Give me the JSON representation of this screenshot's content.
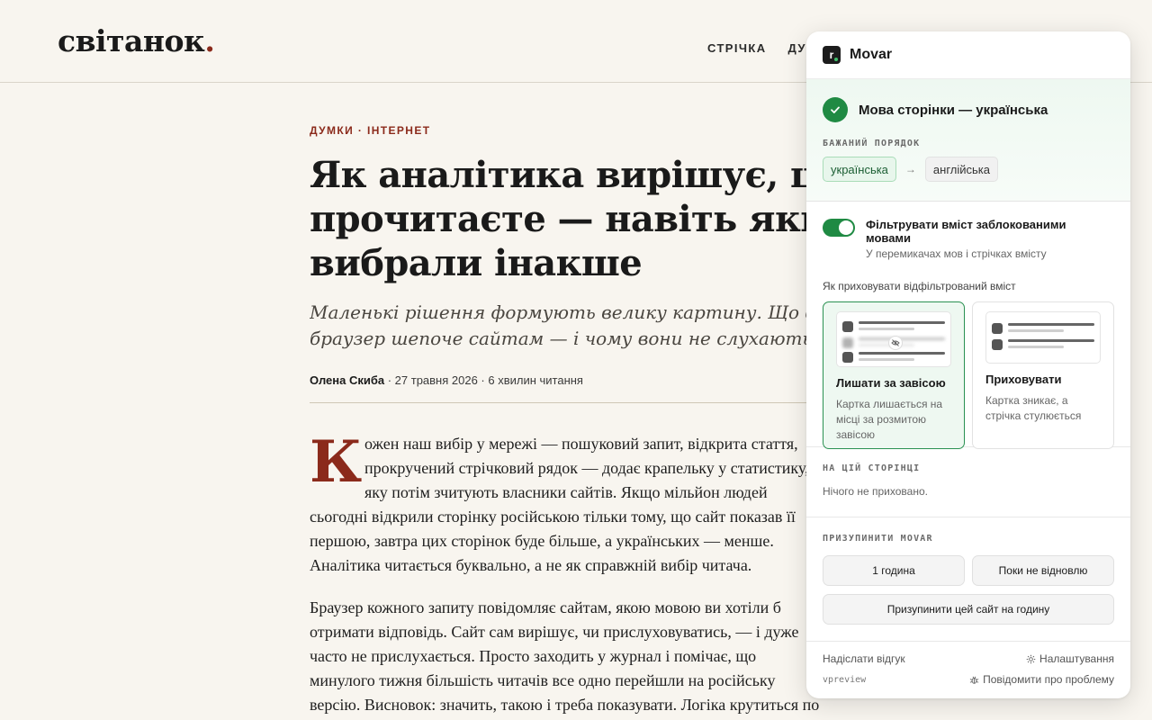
{
  "site": {
    "logo": "світанок",
    "logo_dot": ".",
    "nav": [
      "СТРІЧКА",
      "ДУМКИ"
    ]
  },
  "article": {
    "kicker": "ДУМКИ · ІНТЕРНЕТ",
    "headline_lines": [
      "Як аналітика вирішує, що ви",
      "прочитаєте — навіть якщо ви",
      "вибрали інакше"
    ],
    "dek_lines": [
      "Маленькі рішення формують велику картину. Що ваш",
      "браузер шепоче сайтам — і чому вони не слухають."
    ],
    "author": "Олена Скиба",
    "meta": " · 27 травня 2026 · 6 хвилин читання",
    "dropcap": "К",
    "para1_lines": [
      "ожен наш вибір у мережі — пошуковий запит, відкрита стаття,",
      "прокручений стрічковий рядок — додає крапельку у статистику,",
      "яку потім зчитують власники сайтів. Якщо мільйон людей",
      "сьогодні відкрили сторінку російською тільки тому, що сайт показав її",
      "першою, завтра цих сторінок буде більше, а українських — менше.",
      "Аналітика читається буквально, а не як справжній вибір читача."
    ],
    "para2_lines": [
      "Браузер кожного запиту повідомляє сайтам, якою мовою ви хотіли б",
      "отримати відповідь. Сайт сам вирішує, чи прислуховуватись, — і дуже",
      "часто не прислухається. Просто заходить у журнал і помічає, що",
      "минулого тижня більшість читачів все одно перейшли на російську",
      "версію. Висновок: значить, такою і треба показувати. Логіка крутиться по"
    ]
  },
  "panel": {
    "brand": "Movar",
    "brand_icon": "r",
    "status_title": "Мова сторінки — українська",
    "pref_label": "БАЖАНИЙ ПОРЯДОК",
    "pref_primary": "українська",
    "pref_secondary": "англійська",
    "filter_title": "Фільтрувати вміст заблокованими мовами",
    "filter_sub": "У перемикачах мов і стрічках вмісту",
    "filter_enabled": true,
    "hide_label": "Як приховувати відфільтрований вміст",
    "option_curtain_title": "Лишати за завісою",
    "option_curtain_desc": "Картка лишається на місці за розмитою завісою",
    "option_hide_title": "Приховувати",
    "option_hide_desc": "Картка зникає, а стрічка стулюється",
    "selected_option": "curtain",
    "page_label": "НА ЦІЙ СТОРІНЦІ",
    "page_status": "Нічого не приховано.",
    "pause_label": "ПРИЗУПИНИТИ MOVAR",
    "pause_1h": "1 година",
    "pause_until": "Поки не відновлю",
    "pause_site": "Призупинити цей сайт на годину",
    "feedback": "Надіслати відгук",
    "settings": "Налаштування",
    "version": "vpreview",
    "report": "Повідомити про проблему"
  },
  "colors": {
    "accent_green": "#1f8a43",
    "brand_red": "#8b2a1b",
    "page_bg": "#f8f5ef"
  }
}
